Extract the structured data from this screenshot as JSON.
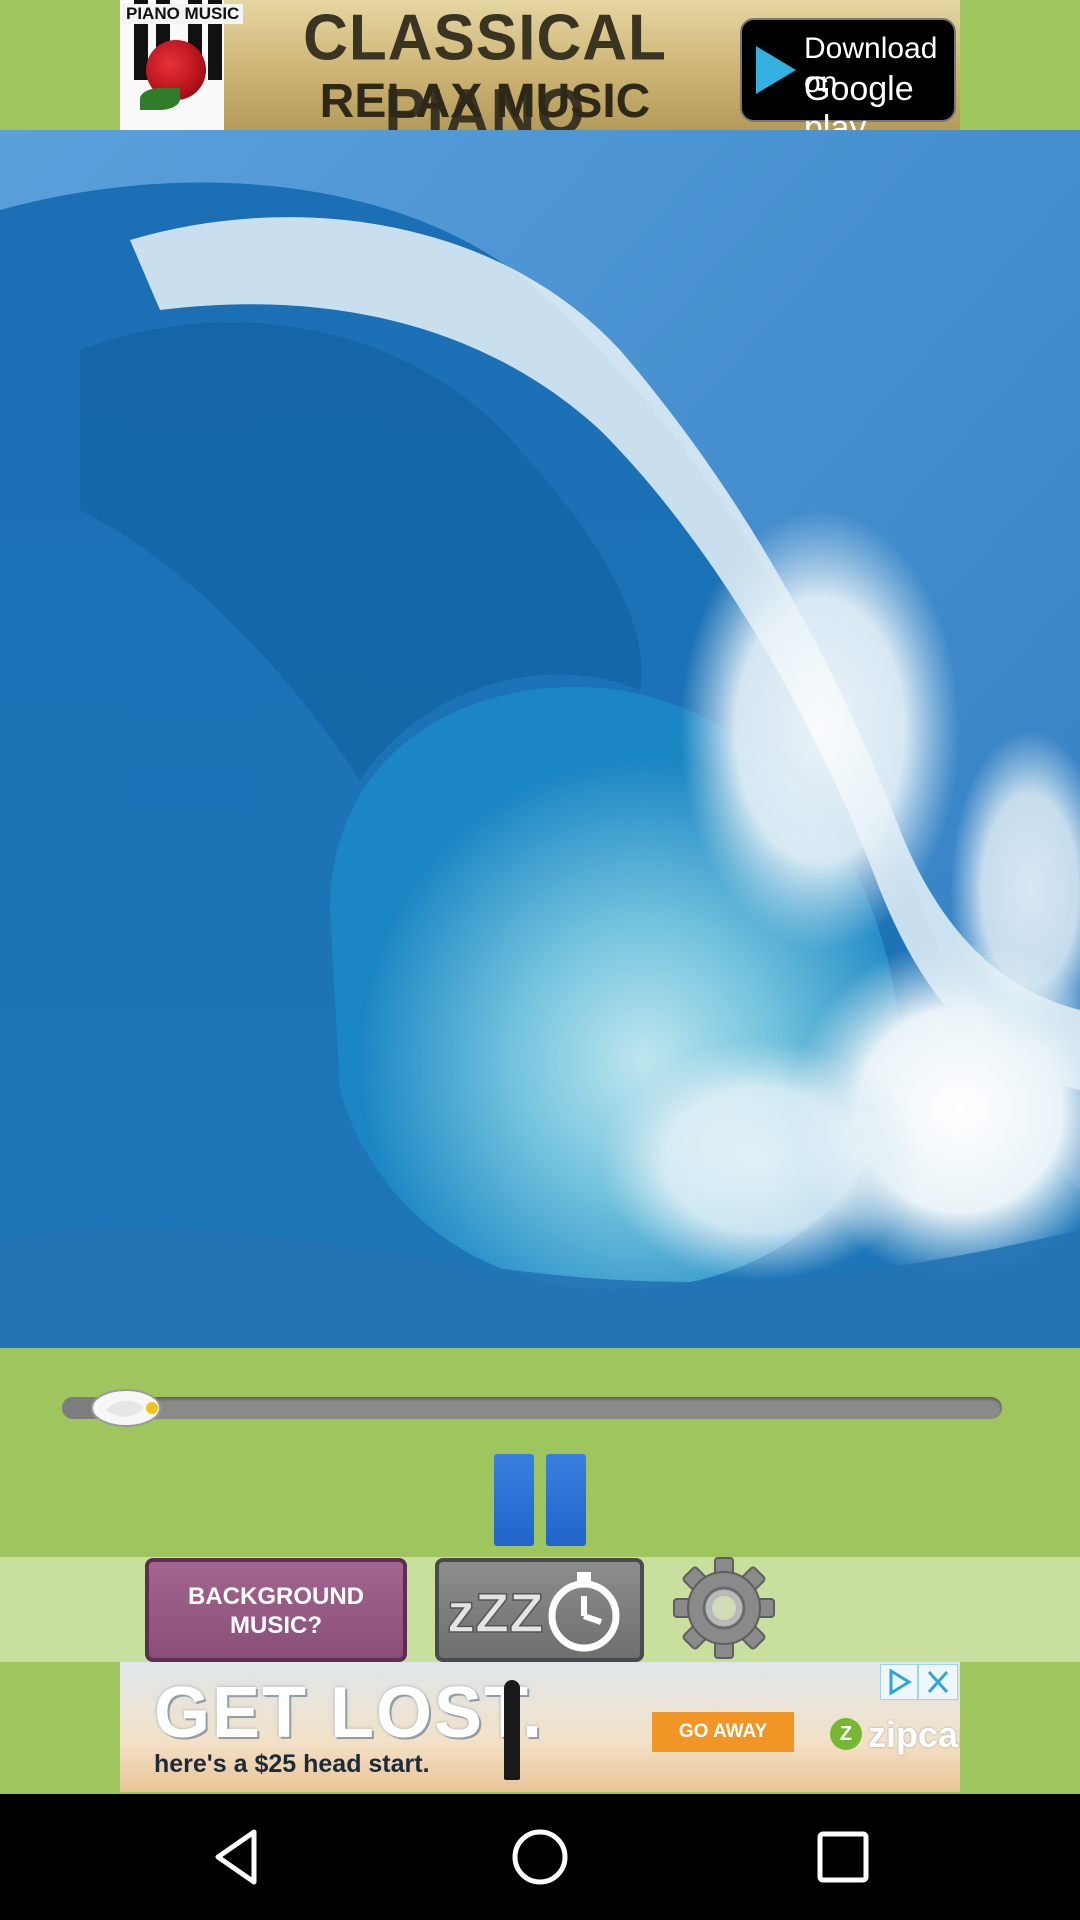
{
  "top_ad": {
    "piano_label": "PIANO MUSIC",
    "title_line1": "CLASSICAL PIANO",
    "title_line2": "RELAX MUSIC",
    "badge_line1": "Download on",
    "badge_line2": "Google play"
  },
  "player": {
    "progress_fraction": 0.04,
    "state": "playing"
  },
  "controls": {
    "background_music_label_line1": "BACKGROUND",
    "background_music_label_line2": "MUSIC?",
    "sleep_timer_text": "zZZ",
    "settings_icon": "gear-icon"
  },
  "bottom_ad": {
    "headline": "GET LOST.",
    "subline": "here's a $25 head start.",
    "cta": "GO AWAY",
    "brand_mark": "Z",
    "brand": "zipcar."
  },
  "colors": {
    "app_background": "#9fc55e",
    "controls_strip": "#c8df9e",
    "pause_button": "#2a6fd6",
    "background_music_button": "#94567f",
    "nav_bar": "#000000"
  }
}
